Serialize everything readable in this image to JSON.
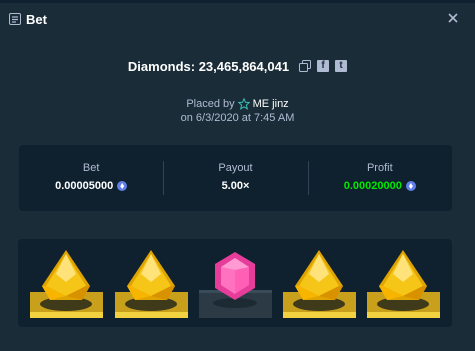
{
  "window": {
    "title": "Bet",
    "title_icon": "bet-slip-icon",
    "close_icon": "close-icon"
  },
  "game": {
    "name": "Diamonds",
    "bet_id": "23,465,864,041",
    "headline": "Diamonds: 23,465,864,041",
    "actions": [
      "copy-icon",
      "facebook-icon",
      "twitter-icon"
    ],
    "facebook_glyph": "f",
    "twitter_glyph": "t"
  },
  "placed": {
    "prefix": "Placed by",
    "user": "ME jinz",
    "date_line": "on 6/3/2020 at 7:45 AM",
    "badge_icon": "star-icon"
  },
  "stats": {
    "bet_label": "Bet",
    "bet_value": "0.00005000",
    "payout_label": "Payout",
    "payout_value": "5.00×",
    "profit_label": "Profit",
    "profit_value": "0.00020000",
    "currency_icon": "eth-icon"
  },
  "gems": [
    "yellow",
    "yellow",
    "pink",
    "yellow",
    "yellow"
  ],
  "colors": {
    "background": "#1a2c38",
    "panel": "#0f212e",
    "muted_text": "#b1bad3",
    "profit_green": "#00e701",
    "yellow_gem": "#f5c518",
    "pink_gem": "#ff5fb5",
    "gold_platform": "#c9a01c",
    "pink_platform": "#2c3a46"
  }
}
